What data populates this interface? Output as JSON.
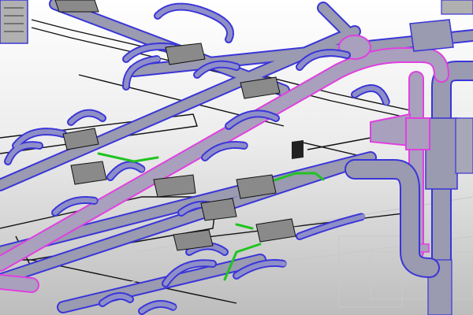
{
  "view": {
    "type": "3d-model-viewport",
    "content": "hvac-ductwork",
    "background_colors": [
      "#ffffff",
      "#bdbdbd"
    ]
  },
  "colors": {
    "duct_fill": "#9a9ab0",
    "duct_outline": "#3a35d8",
    "selected_outline": "#e040e0",
    "green_pipe": "#1fc41f",
    "frame_line": "#111111",
    "box_fill": "#8a8a8a"
  }
}
